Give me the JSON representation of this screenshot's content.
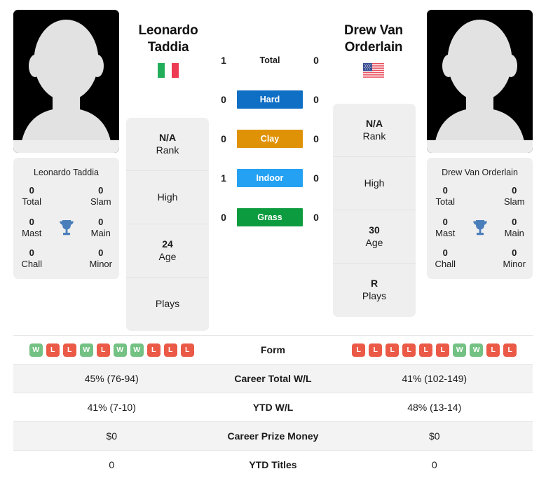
{
  "players": {
    "left": {
      "name_line1": "Leonardo",
      "name_line2": "Taddia",
      "full_name": "Leonardo Taddia",
      "country": "Italy",
      "flag_icon": "flag-italy-icon",
      "avatar_icon": "player-silhouette-avatar",
      "titles": [
        {
          "value": "0",
          "label": "Total"
        },
        {
          "value": "0",
          "label": "Slam"
        },
        {
          "value": "0",
          "label": "Mast"
        },
        {
          "value": "0",
          "label": "Main"
        },
        {
          "value": "0",
          "label": "Chall"
        },
        {
          "value": "0",
          "label": "Minor"
        }
      ],
      "info": [
        {
          "value": "N/A",
          "label": "Rank"
        },
        {
          "value": "",
          "label": "High"
        },
        {
          "value": "24",
          "label": "Age"
        },
        {
          "value": "",
          "label": "Plays"
        }
      ],
      "form": [
        "W",
        "L",
        "L",
        "W",
        "L",
        "W",
        "W",
        "L",
        "L",
        "L"
      ],
      "career_total_wl": "45% (76-94)",
      "ytd_wl": "41% (7-10)",
      "career_prize_money": "$0",
      "ytd_titles": "0"
    },
    "right": {
      "name_line1": "Drew Van",
      "name_line2": "Orderlain",
      "full_name": "Drew Van Orderlain",
      "country": "United States",
      "flag_icon": "flag-usa-icon",
      "avatar_icon": "player-silhouette-avatar",
      "titles": [
        {
          "value": "0",
          "label": "Total"
        },
        {
          "value": "0",
          "label": "Slam"
        },
        {
          "value": "0",
          "label": "Mast"
        },
        {
          "value": "0",
          "label": "Main"
        },
        {
          "value": "0",
          "label": "Chall"
        },
        {
          "value": "0",
          "label": "Minor"
        }
      ],
      "info": [
        {
          "value": "N/A",
          "label": "Rank"
        },
        {
          "value": "",
          "label": "High"
        },
        {
          "value": "30",
          "label": "Age"
        },
        {
          "value": "R",
          "label": "Plays"
        }
      ],
      "form": [
        "L",
        "L",
        "L",
        "L",
        "L",
        "L",
        "W",
        "W",
        "L",
        "L"
      ],
      "career_total_wl": "41% (102-149)",
      "ytd_wl": "48% (13-14)",
      "career_prize_money": "$0",
      "ytd_titles": "0"
    }
  },
  "trophy_icon": "trophy-icon",
  "trophy_color": "#4a7ebb",
  "head_to_head": [
    {
      "label": "Total",
      "left": "1",
      "right": "0",
      "pill": false,
      "color": ""
    },
    {
      "label": "Hard",
      "left": "0",
      "right": "0",
      "pill": true,
      "color": "#0f6fc5"
    },
    {
      "label": "Clay",
      "left": "0",
      "right": "0",
      "pill": true,
      "color": "#e09206"
    },
    {
      "label": "Indoor",
      "left": "1",
      "right": "0",
      "pill": true,
      "color": "#24a1f2"
    },
    {
      "label": "Grass",
      "left": "0",
      "right": "0",
      "pill": true,
      "color": "#0d9b3f"
    }
  ],
  "table": {
    "rows": [
      {
        "label": "Form",
        "type": "form"
      },
      {
        "label": "Career Total W/L",
        "type": "text",
        "key": "career_total_wl"
      },
      {
        "label": "YTD W/L",
        "type": "text",
        "key": "ytd_wl"
      },
      {
        "label": "Career Prize Money",
        "type": "text",
        "key": "career_prize_money"
      },
      {
        "label": "YTD Titles",
        "type": "text",
        "key": "ytd_titles"
      }
    ]
  },
  "colors": {
    "card_bg": "#efefef",
    "win_badge": "#74c184",
    "loss_badge": "#ea5a47",
    "alt_row": "#f3f3f3"
  }
}
